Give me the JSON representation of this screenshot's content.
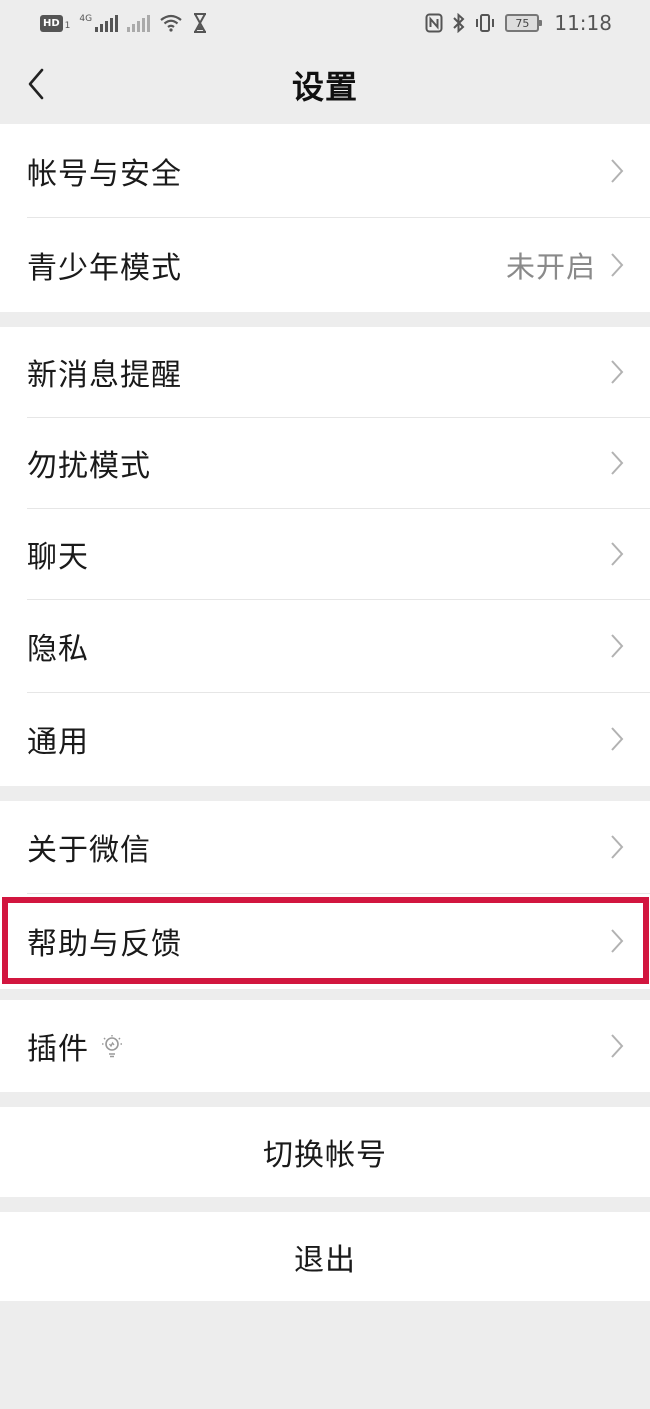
{
  "status_bar": {
    "hd_badge": "HD",
    "sim_slot": "1",
    "network_type": "4G",
    "battery_level": "75",
    "time": "11:18",
    "icons": [
      "hd-icon",
      "signal-icon",
      "signal-off-icon",
      "wifi-icon",
      "hourglass-icon",
      "nfc-icon",
      "bluetooth-icon",
      "vibrate-icon",
      "battery-icon"
    ]
  },
  "header": {
    "title": "设置",
    "back_icon": "chevron-left-icon"
  },
  "groups": [
    {
      "items": [
        {
          "label": "帐号与安全",
          "value": ""
        },
        {
          "label": "青少年模式",
          "value": "未开启"
        }
      ]
    },
    {
      "items": [
        {
          "label": "新消息提醒",
          "value": ""
        },
        {
          "label": "勿扰模式",
          "value": ""
        },
        {
          "label": "聊天",
          "value": ""
        },
        {
          "label": "隐私",
          "value": ""
        },
        {
          "label": "通用",
          "value": ""
        }
      ]
    },
    {
      "items": [
        {
          "label": "关于微信",
          "value": ""
        },
        {
          "label": "帮助与反馈",
          "value": "",
          "highlighted": true
        }
      ]
    },
    {
      "items": [
        {
          "label": "插件",
          "value": "",
          "icon": "lightbulb-icon"
        }
      ]
    }
  ],
  "actions": {
    "switch_account": "切换帐号",
    "logout": "退出"
  },
  "colors": {
    "background": "#ededed",
    "highlight_border": "#d2163f",
    "secondary_text": "#8a8a8a"
  }
}
